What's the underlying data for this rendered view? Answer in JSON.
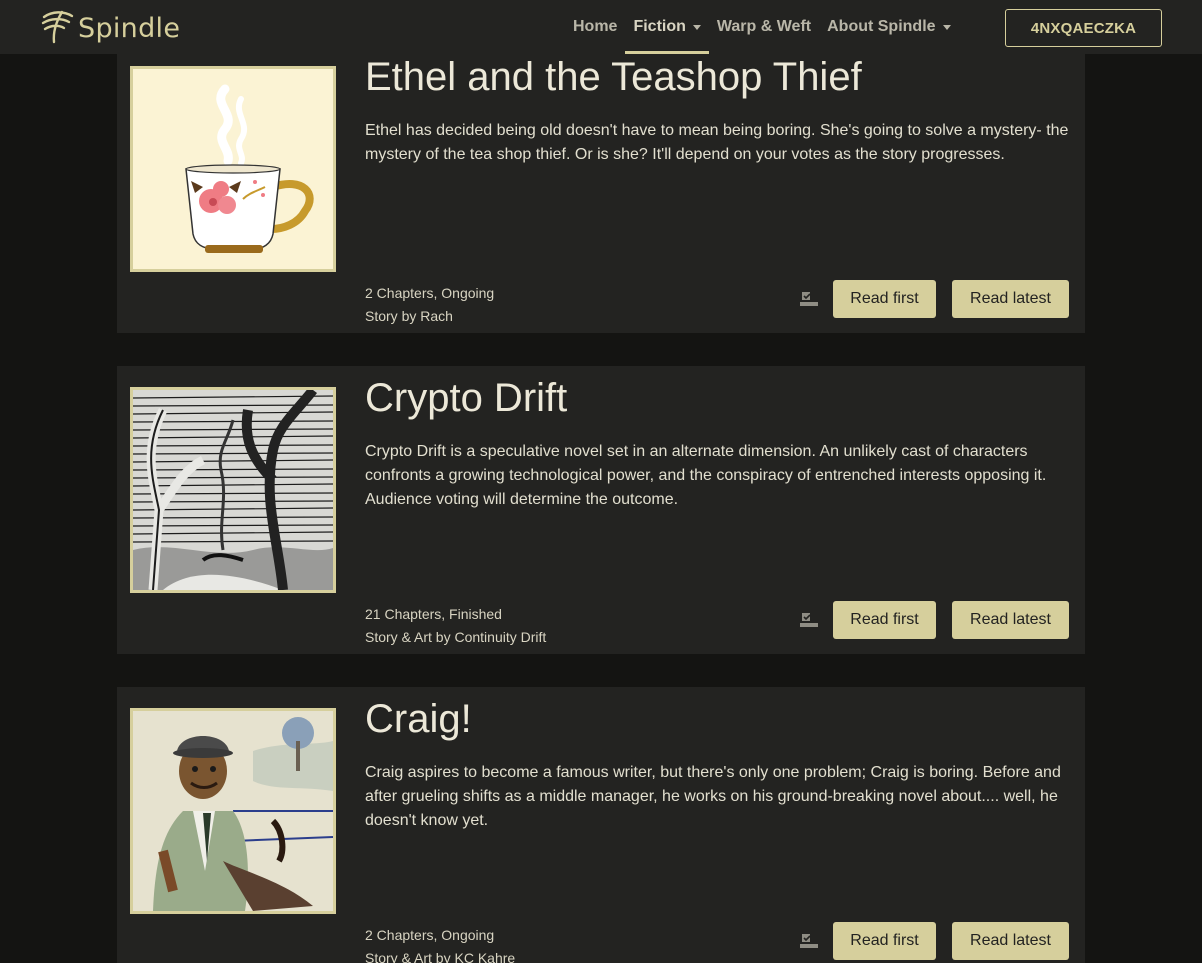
{
  "nav": {
    "brand": "Spindle",
    "links": [
      {
        "label": "Home",
        "dropdown": false,
        "active": false
      },
      {
        "label": "Fiction",
        "dropdown": true,
        "active": true
      },
      {
        "label": "Warp & Weft",
        "dropdown": false,
        "active": false
      },
      {
        "label": "About Spindle",
        "dropdown": true,
        "active": false
      }
    ],
    "account_code": "4NXQA​ECZKA"
  },
  "colors": {
    "accent": "#d6cf9c",
    "card_bg": "#232321",
    "page_bg": "#141412"
  },
  "stories": [
    {
      "title": "Ethel and the Teashop Thief",
      "description": "Ethel has decided being old doesn't have to mean being boring. She's going to solve a mystery- the mystery of the tea shop thief. Or is she? It'll depend on your votes as the story progresses.",
      "chapters": "2 Chapters, Ongoing",
      "credit": "Story by Rach",
      "read_first": "Read first",
      "read_latest": "Read latest",
      "bookmark_icon": "bookmark-add-icon",
      "cover": "teacup"
    },
    {
      "title": "Crypto Drift",
      "description": "Crypto Drift is a speculative novel set in an alternate dimension. An unlikely cast of characters confronts a growing technological power, and the conspiracy of entrenched interests opposing it. Audience voting will determine the outcome.",
      "chapters": "21 Chapters, Finished",
      "credit": "Story & Art by Continuity Drift",
      "read_first": "Read first",
      "read_latest": "Read latest",
      "bookmark_icon": "bookmark-add-icon",
      "cover": "trees"
    },
    {
      "title": "Craig!",
      "description": "Craig aspires to become a famous writer, but there's only one problem; Craig is boring. Before and after grueling shifts as a middle manager, he works on his ground-breaking novel about.... well, he doesn't know yet.",
      "chapters": "2 Chapters, Ongoing",
      "credit": "Story & Art by KC Kahre",
      "read_first": "Read first",
      "read_latest": "Read latest",
      "bookmark_icon": "bookmark-add-icon",
      "cover": "man"
    }
  ]
}
